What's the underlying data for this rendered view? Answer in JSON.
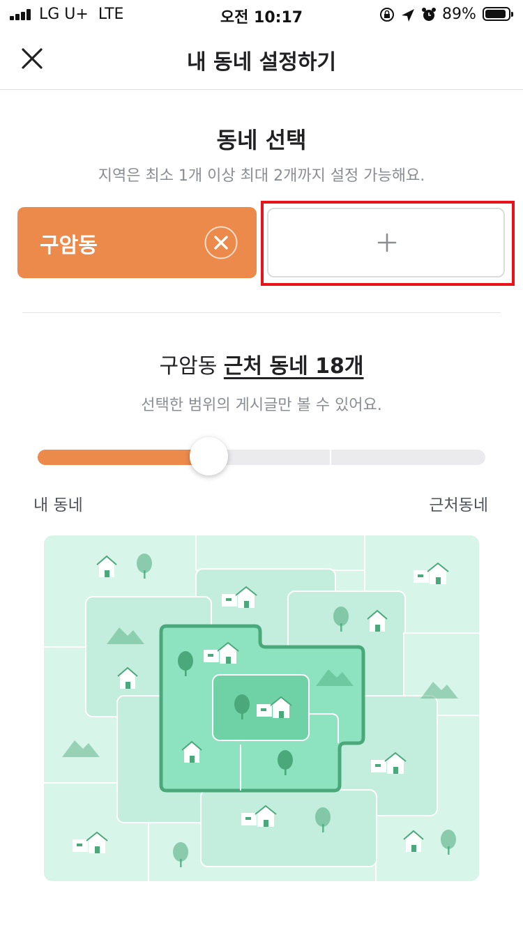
{
  "status_bar": {
    "carrier": "LG U+",
    "network": "LTE",
    "time": "오전 10:17",
    "battery": "89%",
    "battery_level": 0.89,
    "icons": [
      "signal-icon",
      "lock-rotation-icon",
      "location-arrow-icon",
      "alarm-icon",
      "battery-icon"
    ]
  },
  "nav": {
    "title": "내 동네 설정하기",
    "close_icon": "close-icon"
  },
  "neighborhood_select": {
    "title": "동네 선택",
    "subtitle": "지역은 최소 1개 이상 최대 2개까지 설정 가능해요.",
    "selected": [
      {
        "label": "구암동"
      }
    ],
    "add_icon": "plus-icon"
  },
  "range": {
    "title_prefix": "구암동",
    "title_link": "근처 동네 18개",
    "subtitle": "선택한 범위의 게시글만 볼 수 있어요.",
    "slider_level": 0.36,
    "min_label": "내 동네",
    "max_label": "근처동네"
  },
  "colors": {
    "accent": "#ec8a4b",
    "highlight_box": "#e8141a",
    "map_light": "#d8f5ea",
    "map_mid": "#c3eedd",
    "map_selected": "#8de3bf",
    "map_border": "#4aa87b"
  }
}
